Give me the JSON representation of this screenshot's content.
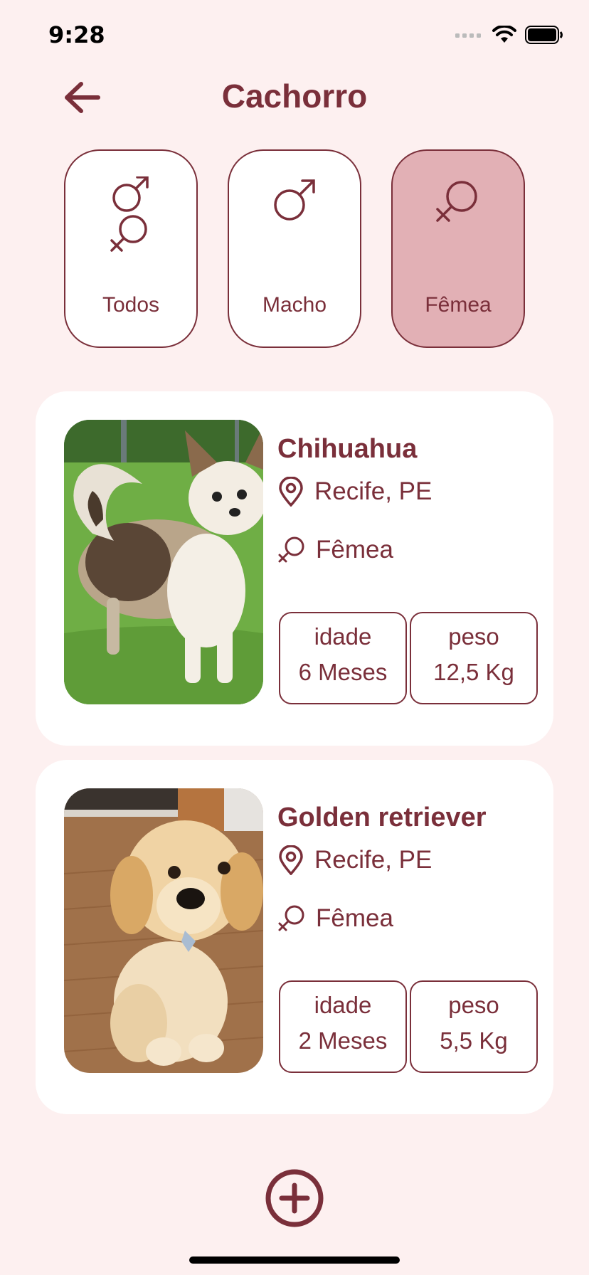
{
  "status_bar": {
    "time": "9:28"
  },
  "header": {
    "title": "Cachorro",
    "back_icon": "arrow-left-icon"
  },
  "filters": [
    {
      "label": "Todos",
      "icon": "male-female-icon",
      "active": false
    },
    {
      "label": "Macho",
      "icon": "male-icon",
      "active": false
    },
    {
      "label": "Fêmea",
      "icon": "female-icon",
      "active": true
    }
  ],
  "pets": [
    {
      "name": "Chihuahua",
      "location": "Recife, PE",
      "sex": "Fêmea",
      "age_label": "idade",
      "age": "6 Meses",
      "weight_label": "peso",
      "weight": "12,5 Kg"
    },
    {
      "name": "Golden retriever",
      "location": "Recife, PE",
      "sex": "Fêmea",
      "age_label": "idade",
      "age": "2 Meses",
      "weight_label": "peso",
      "weight": "5,5 Kg"
    }
  ],
  "colors": {
    "background": "#fdf0f0",
    "accent": "#7a2f3a",
    "active_filter": "#e2b0b5",
    "card": "#ffffff"
  },
  "add_button": {
    "icon": "plus-circle-icon"
  }
}
